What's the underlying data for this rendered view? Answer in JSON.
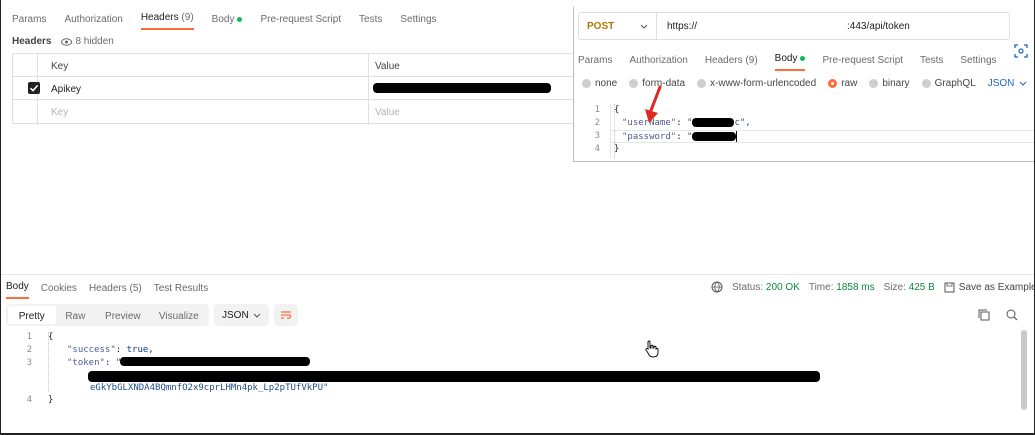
{
  "request_tabs": {
    "params": "Params",
    "authorization": "Authorization",
    "headers": "Headers",
    "headers_count": "(9)",
    "body": "Body",
    "pre_request": "Pre-request Script",
    "tests": "Tests",
    "settings": "Settings"
  },
  "headers_panel": {
    "label": "Headers",
    "hidden": "8 hidden",
    "col_key": "Key",
    "col_value": "Value",
    "row_key": "Apikey",
    "placeholder_key": "Key",
    "placeholder_value": "Value"
  },
  "overlay": {
    "method": "POST",
    "url_prefix": "https://",
    "url_suffix": ":443/api/token",
    "tabs": {
      "params": "Params",
      "authorization": "Authorization",
      "headers": "Headers",
      "headers_count": "(9)",
      "body": "Body",
      "pre_request": "Pre-request Script",
      "tests": "Tests",
      "settings": "Settings"
    },
    "body_types": {
      "none": "none",
      "form_data": "form-data",
      "urlencoded": "x-www-form-urlencoded",
      "raw": "raw",
      "binary": "binary",
      "graphql": "GraphQL",
      "format": "JSON"
    },
    "code": {
      "l1": "1",
      "l2": "2",
      "l3": "3",
      "l4": "4",
      "open": "{",
      "username_key": "\"userName\"",
      "password_key": "\"password\"",
      "colon": ":",
      "quote": "\"",
      "tail2": "c\",",
      "close": "}"
    }
  },
  "response": {
    "tabs": {
      "body": "Body",
      "cookies": "Cookies",
      "headers": "Headers (5)",
      "test_results": "Test Results"
    },
    "status_label": "Status:",
    "status_value": "200 OK",
    "time_label": "Time:",
    "time_value": "1858 ms",
    "size_label": "Size:",
    "size_value": "425 B",
    "save_example": "Save as Example",
    "more": "ooo",
    "views": {
      "pretty": "Pretty",
      "raw": "Raw",
      "preview": "Preview",
      "visualize": "Visualize",
      "format": "JSON"
    },
    "code": {
      "l1": "1",
      "l2": "2",
      "l3": "3",
      "l4": "4",
      "open": "{",
      "success_key": "\"success\"",
      "success_val": "true,",
      "token_key": "\"token\"",
      "token_tail": "eGkYbGLXNDA4BQmnfO2x9cprLHMn4pk_Lp2pTUfVkPU\"",
      "close": "}"
    }
  }
}
